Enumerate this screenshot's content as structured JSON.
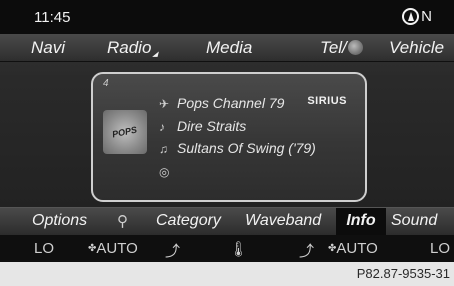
{
  "status_bar": {
    "time": "11:45",
    "compass_heading": "N"
  },
  "main_menu": {
    "navi": "Navi",
    "radio": "Radio",
    "media": "Media",
    "tel": "Tel/",
    "vehicle": "Vehicle"
  },
  "station": {
    "preset": "4",
    "logo_text": "POPS",
    "channel": "Pops Channel 79",
    "artist": "Dire Straits",
    "title": "Sultans Of Swing ('79)",
    "provider": "SIRIUS"
  },
  "soft_menu": {
    "options": "Options",
    "category": "Category",
    "waveband": "Waveband",
    "info": "Info",
    "sound": "Sound",
    "selected": "Info"
  },
  "climate": {
    "left_temp": "LO",
    "left_mode": "AUTO",
    "right_mode": "AUTO",
    "right_temp": "LO"
  },
  "caption": "P82.87-9535-31"
}
